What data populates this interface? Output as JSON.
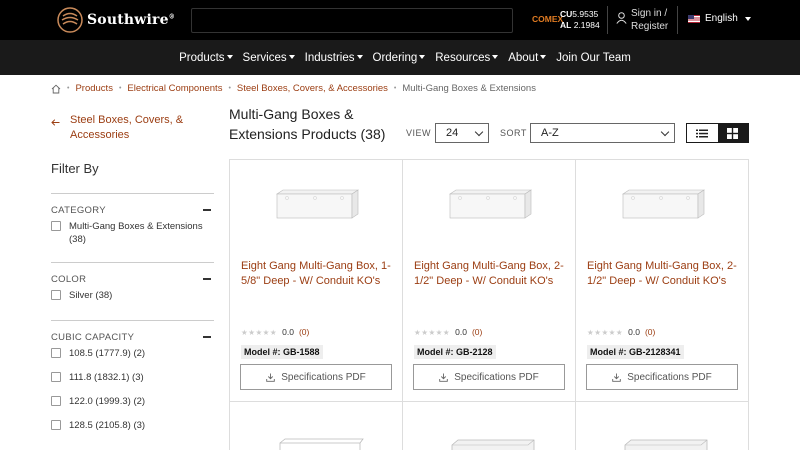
{
  "header": {
    "logo_text": "Southwire",
    "logo_tm": "®",
    "comex": {
      "label": "COMEX",
      "rows": [
        {
          "symbol": "CU",
          "value": "5.9535"
        },
        {
          "symbol": "AL",
          "value": "2.1984"
        }
      ]
    },
    "signin": {
      "line1": "Sign in /",
      "line2": "Register"
    },
    "language": "English"
  },
  "nav": {
    "items": [
      {
        "label": "Products",
        "dropdown": true
      },
      {
        "label": "Services",
        "dropdown": true
      },
      {
        "label": "Industries",
        "dropdown": true
      },
      {
        "label": "Ordering",
        "dropdown": true
      },
      {
        "label": "Resources",
        "dropdown": true
      },
      {
        "label": "About",
        "dropdown": true
      },
      {
        "label": "Join Our Team",
        "dropdown": false
      }
    ]
  },
  "breadcrumb": {
    "links": [
      "Products",
      "Electrical Components",
      "Steel Boxes, Covers, & Accessories"
    ],
    "current": "Multi-Gang Boxes & Extensions"
  },
  "sidebar": {
    "back_line1": "Steel Boxes, Covers, &",
    "back_line2": "Accessories",
    "filter_title": "Filter By",
    "sections": [
      {
        "title": "CATEGORY",
        "options": [
          {
            "label": "Multi-Gang Boxes & Extensions",
            "count": "(38)"
          }
        ]
      },
      {
        "title": "COLOR",
        "options": [
          {
            "label": "Silver",
            "count": "(38)"
          }
        ]
      },
      {
        "title": "CUBIC CAPACITY",
        "options": [
          {
            "label": "108.5 (1777.9)",
            "count": "(2)"
          },
          {
            "label": "111.8 (1832.1)",
            "count": "(3)"
          },
          {
            "label": "122.0 (1999.3)",
            "count": "(2)"
          },
          {
            "label": "128.5 (2105.8)",
            "count": "(3)"
          }
        ]
      }
    ]
  },
  "main": {
    "title_line1": "Multi-Gang Boxes &",
    "title_line2": "Extensions Products (38)",
    "view_label": "VIEW",
    "view_value": "24",
    "sort_label": "SORT",
    "sort_value": "A-Z",
    "products": [
      {
        "title": "Eight Gang Multi-Gang Box, 1-5/8\" Deep - W/ Conduit KO's",
        "rating": "0.0",
        "reviews": "(0)",
        "model_label": "Model #:",
        "model": "GB-1588",
        "spec_label": "Specifications PDF"
      },
      {
        "title": "Eight Gang Multi-Gang Box, 2-1/2\" Deep - W/ Conduit KO's",
        "rating": "0.0",
        "reviews": "(0)",
        "model_label": "Model #:",
        "model": "GB-2128",
        "spec_label": "Specifications PDF"
      },
      {
        "title": "Eight Gang Multi-Gang Box, 2-1/2\" Deep - W/ Conduit KO's",
        "rating": "0.0",
        "reviews": "(0)",
        "model_label": "Model #:",
        "model": "GB-2128341",
        "spec_label": "Specifications PDF"
      }
    ]
  },
  "colors": {
    "accent": "#9b3d12",
    "header_bg": "#000000",
    "nav_bg": "#1a1a1a",
    "comex": "#e07b22"
  }
}
